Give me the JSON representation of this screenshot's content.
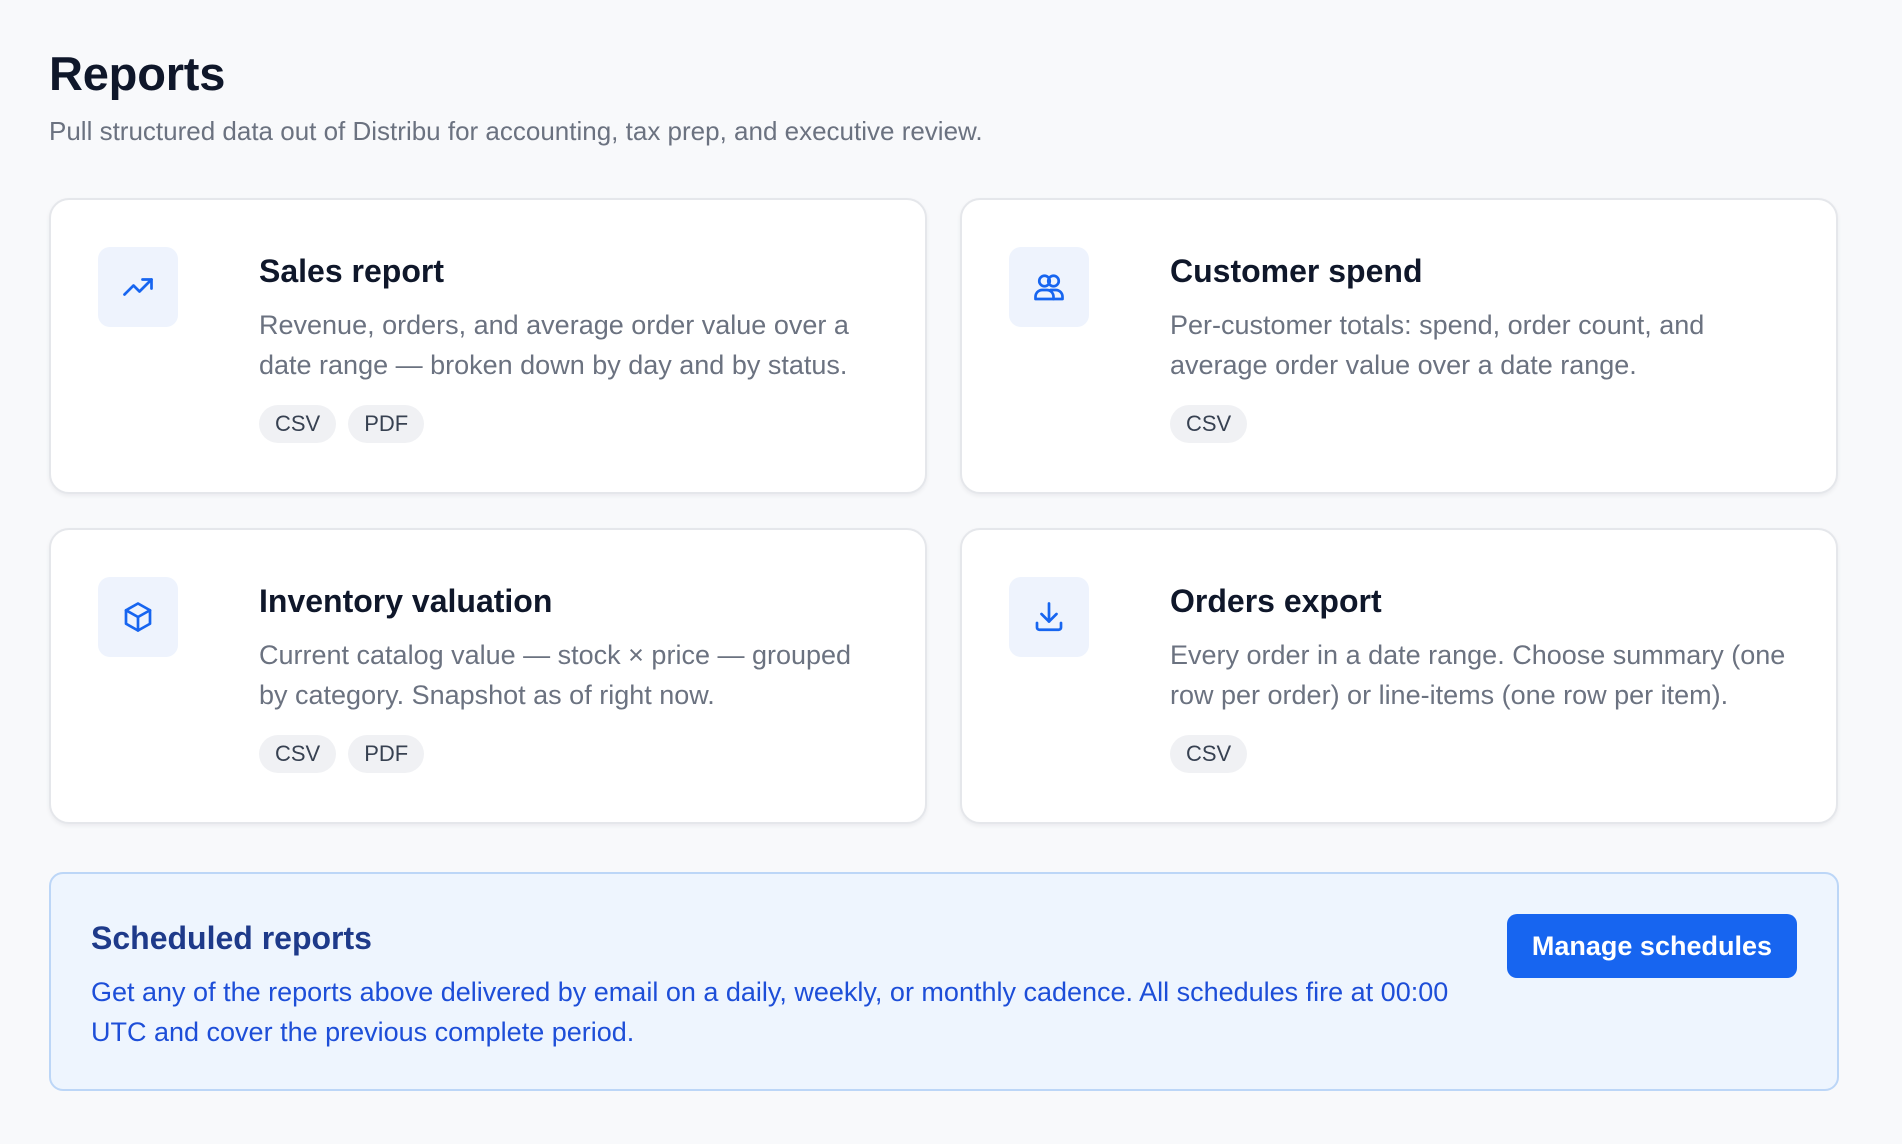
{
  "header": {
    "title": "Reports",
    "subtitle": "Pull structured data out of Distribu for accounting, tax prep, and executive review."
  },
  "colors": {
    "accent": "#1765f0",
    "icon_bg": "#eef3fd",
    "banner_bg": "#eef5fe",
    "banner_title": "#1e3a8a",
    "banner_text": "#1d4ed8"
  },
  "reports": [
    {
      "icon": "trending-up-icon",
      "title": "Sales report",
      "description": "Revenue, orders, and average order value over a date range — broken down by day and by status.",
      "formats": [
        "CSV",
        "PDF"
      ]
    },
    {
      "icon": "users-icon",
      "title": "Customer spend",
      "description": "Per-customer totals: spend, order count, and average order value over a date range.",
      "formats": [
        "CSV"
      ]
    },
    {
      "icon": "box-icon",
      "title": "Inventory valuation",
      "description": "Current catalog value — stock × price — grouped by category. Snapshot as of right now.",
      "formats": [
        "CSV",
        "PDF"
      ]
    },
    {
      "icon": "download-icon",
      "title": "Orders export",
      "description": "Every order in a date range. Choose summary (one row per order) or line-items (one row per item).",
      "formats": [
        "CSV"
      ]
    }
  ],
  "scheduled": {
    "title": "Scheduled reports",
    "description": "Get any of the reports above delivered by email on a daily, weekly, or monthly cadence. All schedules fire at 00:00 UTC and cover the previous complete period.",
    "button_label": "Manage schedules"
  }
}
